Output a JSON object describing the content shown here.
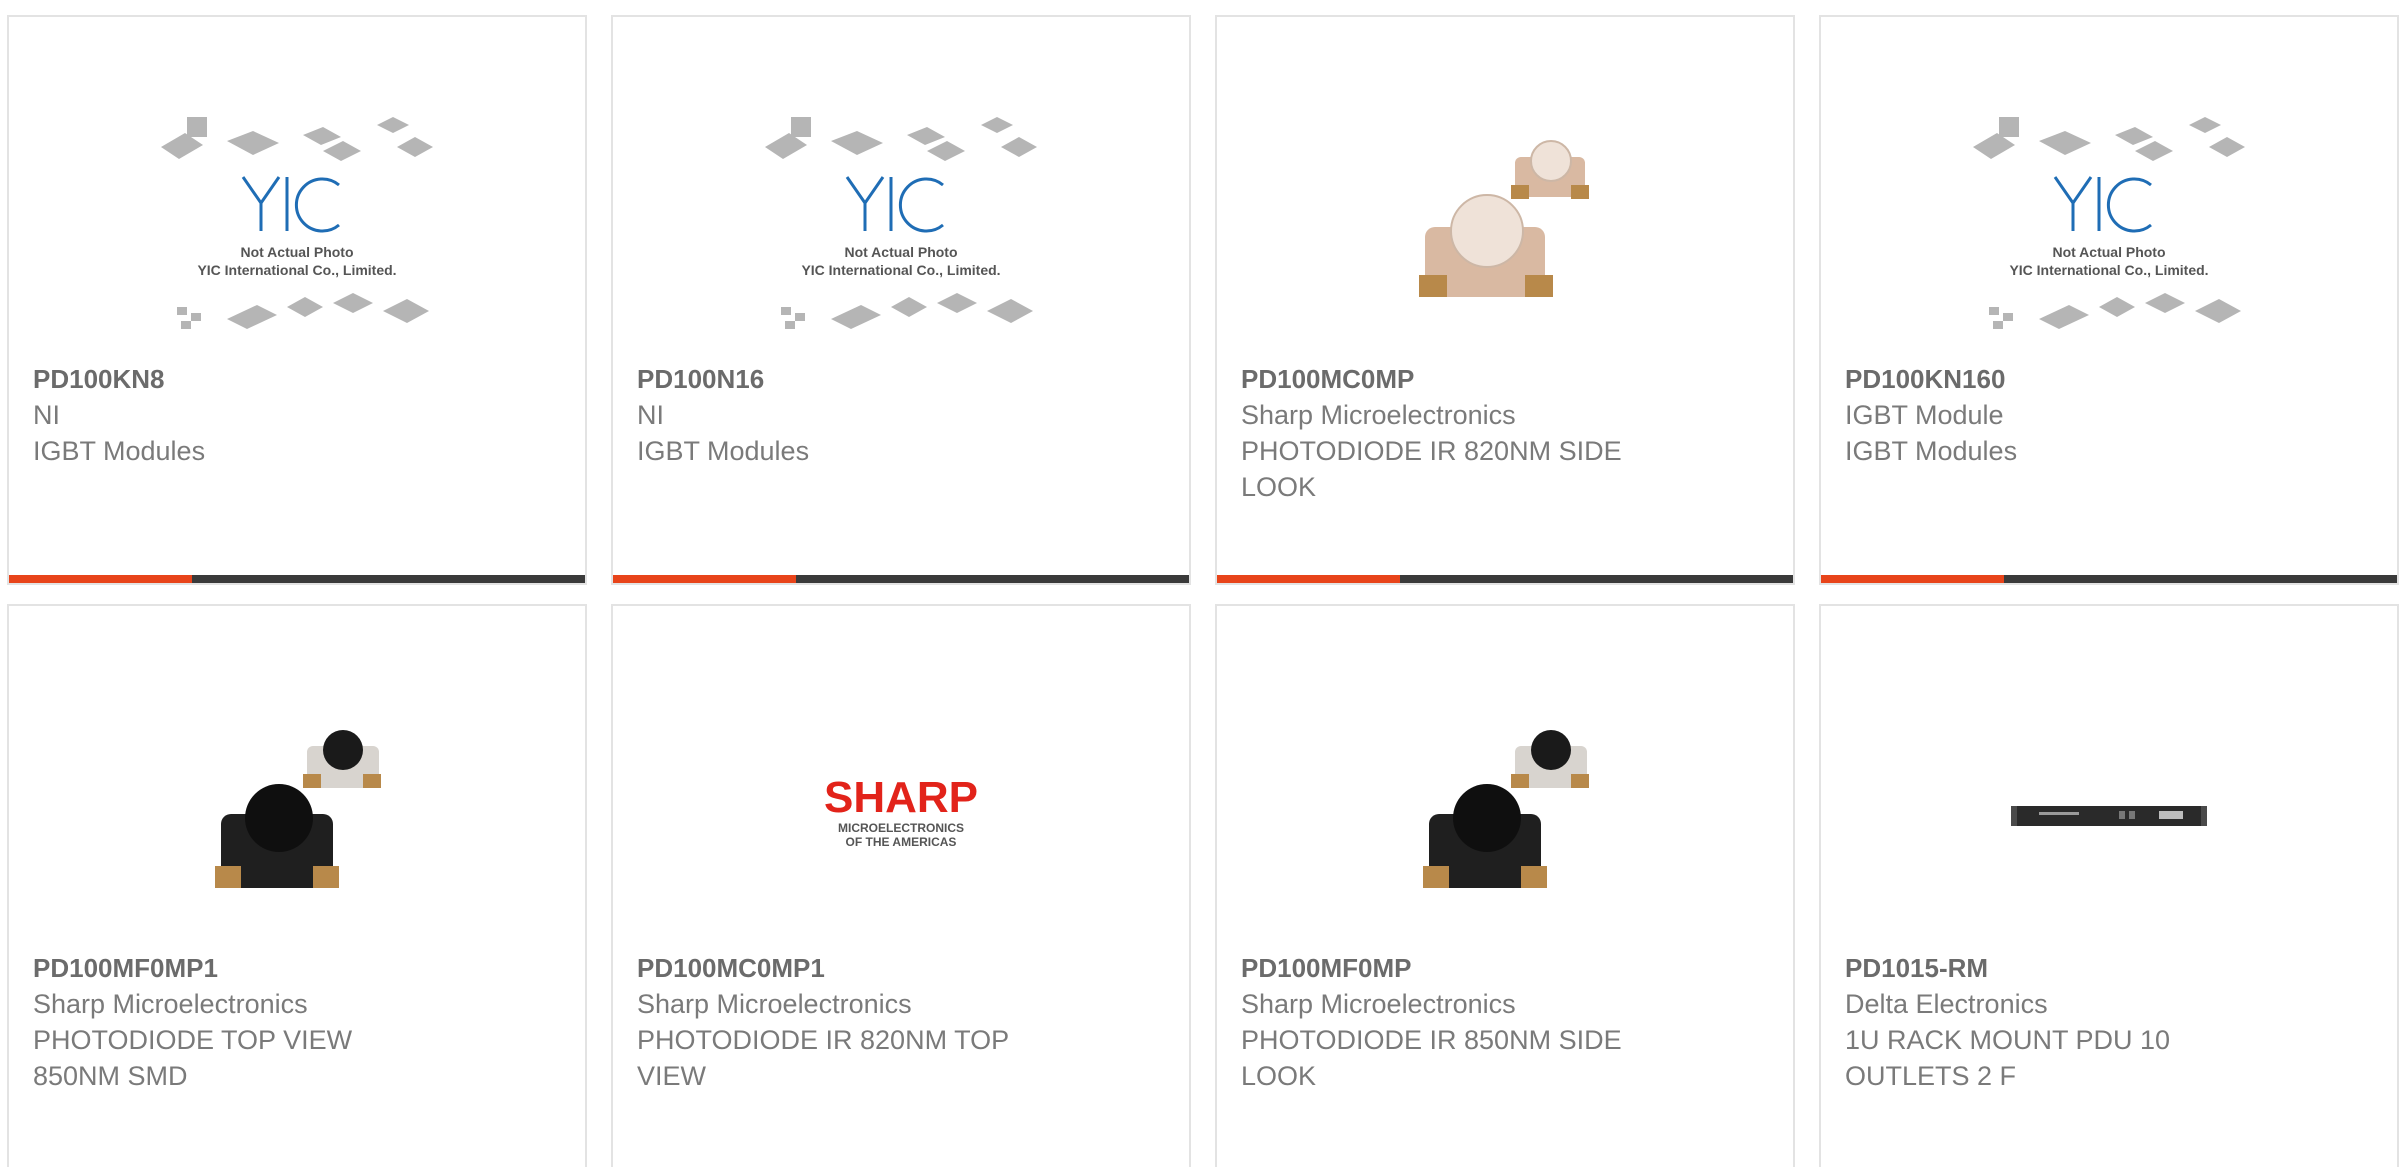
{
  "products": [
    {
      "part": "PD100KN8",
      "maker": "NI",
      "desc1": "IGBT Modules",
      "desc2": "",
      "image": "yic-placeholder",
      "img_line1": "Not Actual Photo",
      "img_line2": "YIC International Co., Limited."
    },
    {
      "part": "PD100N16",
      "maker": "NI",
      "desc1": "IGBT Modules",
      "desc2": "",
      "image": "yic-placeholder",
      "img_line1": "Not Actual Photo",
      "img_line2": "YIC International Co., Limited."
    },
    {
      "part": "PD100MC0MP",
      "maker": "Sharp Microelectronics",
      "desc1": "PHOTODIODE IR 820NM SIDE",
      "desc2": "LOOK",
      "image": "clear-photodiode"
    },
    {
      "part": "PD100KN160",
      "maker": "IGBT Module",
      "desc1": "IGBT Modules",
      "desc2": "",
      "image": "yic-placeholder",
      "img_line1": "Not Actual Photo",
      "img_line2": "YIC International Co., Limited."
    },
    {
      "part": "PD100MF0MP1",
      "maker": "Sharp Microelectronics",
      "desc1": "PHOTODIODE TOP VIEW",
      "desc2": "850NM SMD",
      "image": "black-photodiode"
    },
    {
      "part": "PD100MC0MP1",
      "maker": "Sharp Microelectronics",
      "desc1": "PHOTODIODE IR 820NM TOP",
      "desc2": "VIEW",
      "image": "sharp-logo",
      "logo_text": "SHARP",
      "logo_sub1": "MICROELECTRONICS",
      "logo_sub2": "OF THE AMERICAS"
    },
    {
      "part": "PD100MF0MP",
      "maker": "Sharp Microelectronics",
      "desc1": "PHOTODIODE IR 850NM SIDE",
      "desc2": "LOOK",
      "image": "black-photodiode"
    },
    {
      "part": "PD1015-RM",
      "maker": "Delta Electronics",
      "desc1": "1U RACK MOUNT PDU 10",
      "desc2": "OUTLETS 2 F",
      "image": "rack-pdu"
    }
  ],
  "colors": {
    "accent": "#e8441a",
    "bar": "#3a3a3a",
    "text": "#7a7a7a"
  }
}
